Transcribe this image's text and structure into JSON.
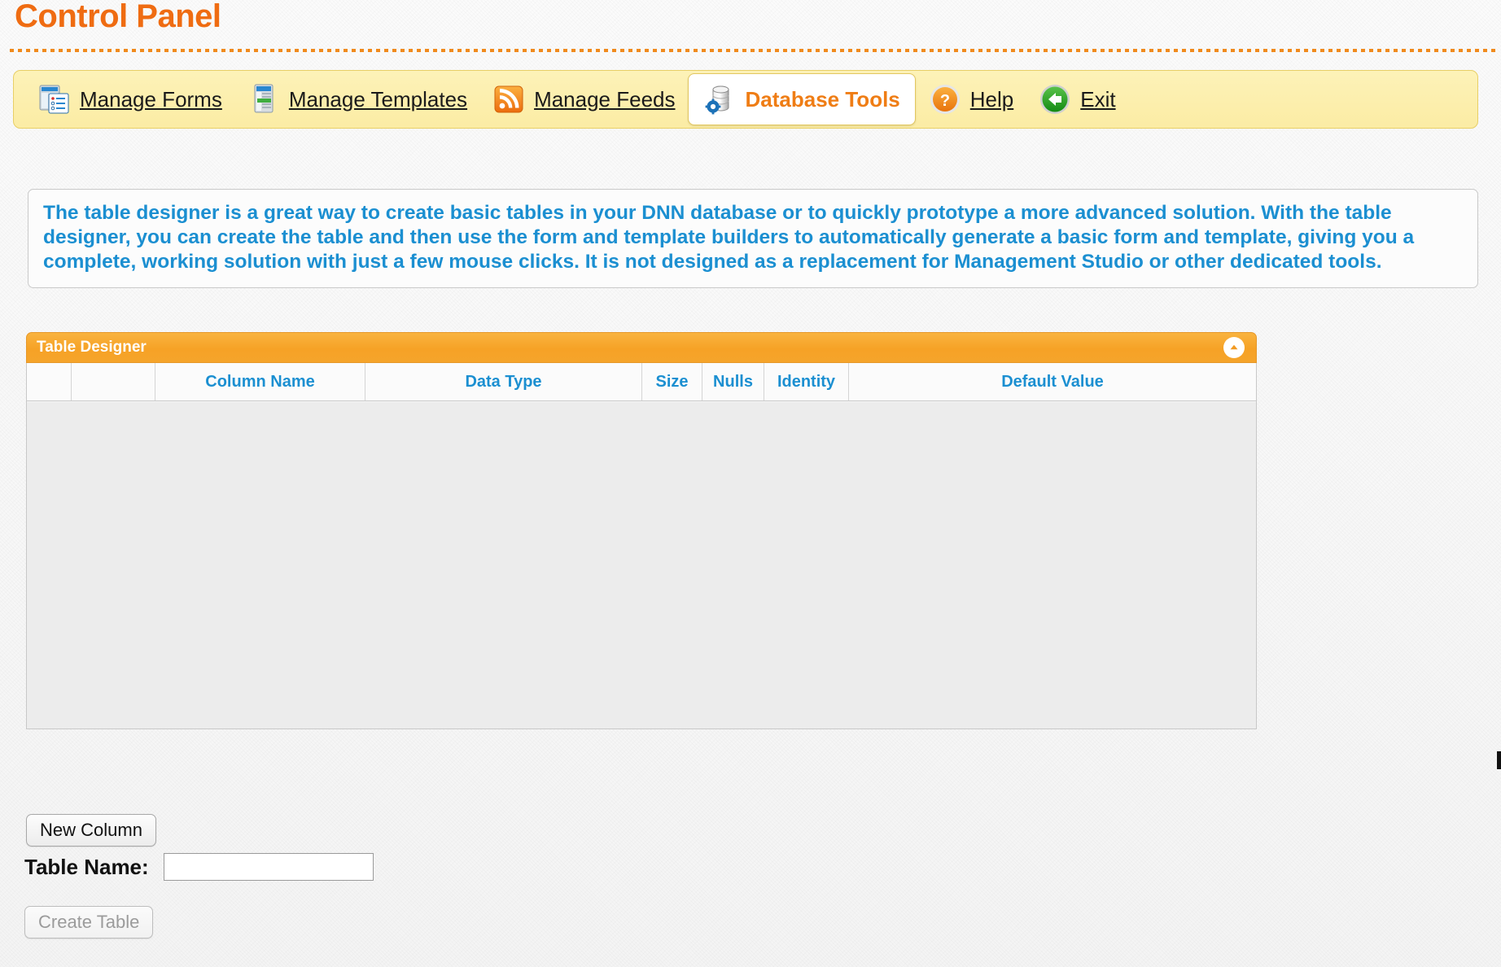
{
  "header": {
    "title": "Control Panel"
  },
  "toolbar": {
    "items": [
      {
        "label": "Manage Forms",
        "icon": "forms-icon",
        "active": false
      },
      {
        "label": "Manage Templates",
        "icon": "templates-icon",
        "active": false
      },
      {
        "label": "Manage Feeds",
        "icon": "rss-feed-icon",
        "active": false
      },
      {
        "label": "Database Tools",
        "icon": "database-tools-icon",
        "active": true
      },
      {
        "label": "Help",
        "icon": "help-icon",
        "active": false
      },
      {
        "label": "Exit",
        "icon": "exit-icon",
        "active": false
      }
    ]
  },
  "info": {
    "text": "The table designer is a great way to create basic tables in your DNN database or to quickly prototype a more advanced solution. With the table designer, you can create the table and then use the form and template builders to automatically generate a basic form and template, giving you a complete, working solution with just a few mouse clicks. It is not designed as a replacement for Management Studio or other dedicated tools."
  },
  "designer": {
    "title": "Table Designer",
    "collapse_icon": "chevron-up-icon",
    "columns": [
      {
        "key": "handle",
        "label": ""
      },
      {
        "key": "actions",
        "label": ""
      },
      {
        "key": "name",
        "label": "Column Name"
      },
      {
        "key": "datatype",
        "label": "Data Type"
      },
      {
        "key": "size",
        "label": "Size"
      },
      {
        "key": "nulls",
        "label": "Nulls"
      },
      {
        "key": "identity",
        "label": "Identity"
      },
      {
        "key": "default",
        "label": "Default Value"
      }
    ],
    "rows": []
  },
  "actions": {
    "new_column_label": "New Column",
    "create_table_label": "Create Table",
    "create_table_enabled": false
  },
  "form": {
    "table_name_label": "Table Name:",
    "table_name_value": "",
    "table_name_placeholder": ""
  },
  "colors": {
    "accent_orange": "#ef6c12",
    "panel_header_orange": "#f6a226",
    "link_blue": "#1b8fd1",
    "toolbar_yellow": "#fbeca4",
    "grid_body_grey": "#ececec"
  }
}
